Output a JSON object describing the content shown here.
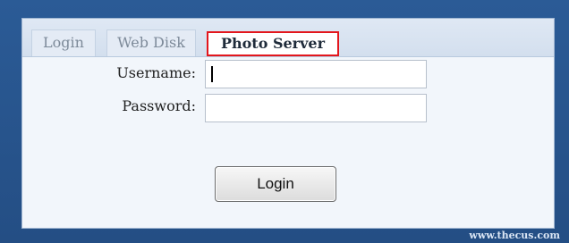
{
  "tabs": [
    {
      "label": "Login",
      "selected": false
    },
    {
      "label": "Web Disk",
      "selected": false
    },
    {
      "label": "Photo Server",
      "selected": true,
      "highlighted": true
    }
  ],
  "form": {
    "username_label": "Username:",
    "password_label": "Password:",
    "username_value": "",
    "password_value": ""
  },
  "login_button_label": "Login",
  "brand_url": "www.thecus.com",
  "colors": {
    "frame": "#2b5b96",
    "panel": "#eaf0f8",
    "highlight_border": "#e3161c"
  }
}
